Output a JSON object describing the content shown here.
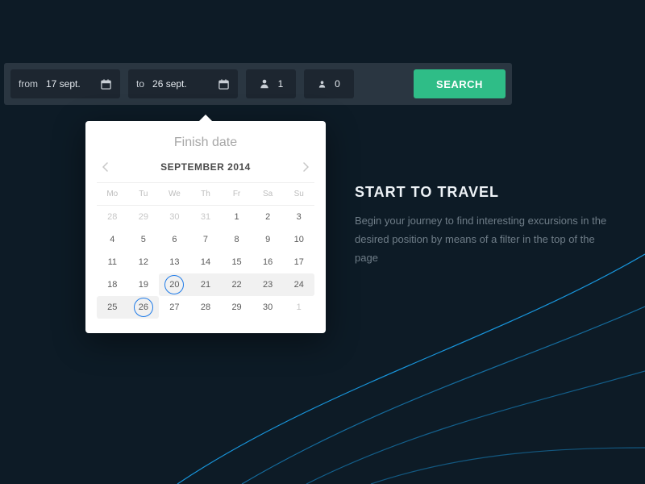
{
  "search": {
    "from_prefix": "from",
    "from_value": "17 sept.",
    "to_prefix": "to",
    "to_value": "26 sept.",
    "adults": "1",
    "children": "0",
    "button": "SEARCH"
  },
  "popover": {
    "title": "Finish date",
    "month": "SEPTEMBER 2014",
    "dow": [
      "Mo",
      "Tu",
      "We",
      "Th",
      "Fr",
      "Sa",
      "Su"
    ],
    "weeks": [
      [
        {
          "d": "28",
          "out": true
        },
        {
          "d": "29",
          "out": true
        },
        {
          "d": "30",
          "out": true
        },
        {
          "d": "31",
          "out": true
        },
        {
          "d": "1"
        },
        {
          "d": "2"
        },
        {
          "d": "3"
        }
      ],
      [
        {
          "d": "4"
        },
        {
          "d": "5"
        },
        {
          "d": "6"
        },
        {
          "d": "7"
        },
        {
          "d": "8"
        },
        {
          "d": "9"
        },
        {
          "d": "10"
        }
      ],
      [
        {
          "d": "11"
        },
        {
          "d": "12"
        },
        {
          "d": "13"
        },
        {
          "d": "14"
        },
        {
          "d": "15"
        },
        {
          "d": "16"
        },
        {
          "d": "17"
        }
      ],
      [
        {
          "d": "18"
        },
        {
          "d": "19"
        },
        {
          "d": "20",
          "circ": true,
          "range": true,
          "range_l": true
        },
        {
          "d": "21",
          "range": true
        },
        {
          "d": "22",
          "range": true
        },
        {
          "d": "23",
          "range": true
        },
        {
          "d": "24",
          "range": true,
          "range_r": true
        }
      ],
      [
        {
          "d": "25",
          "range": true,
          "range_l": true
        },
        {
          "d": "26",
          "circ": true,
          "range": true,
          "range_r": true
        },
        {
          "d": "27"
        },
        {
          "d": "28"
        },
        {
          "d": "29"
        },
        {
          "d": "30"
        },
        {
          "d": "1",
          "out": true
        }
      ]
    ]
  },
  "promo": {
    "heading": "START TO TRAVEL",
    "body": "Begin your journey to find interesting excursions in the desired position by means of a filter in the top of the page"
  }
}
